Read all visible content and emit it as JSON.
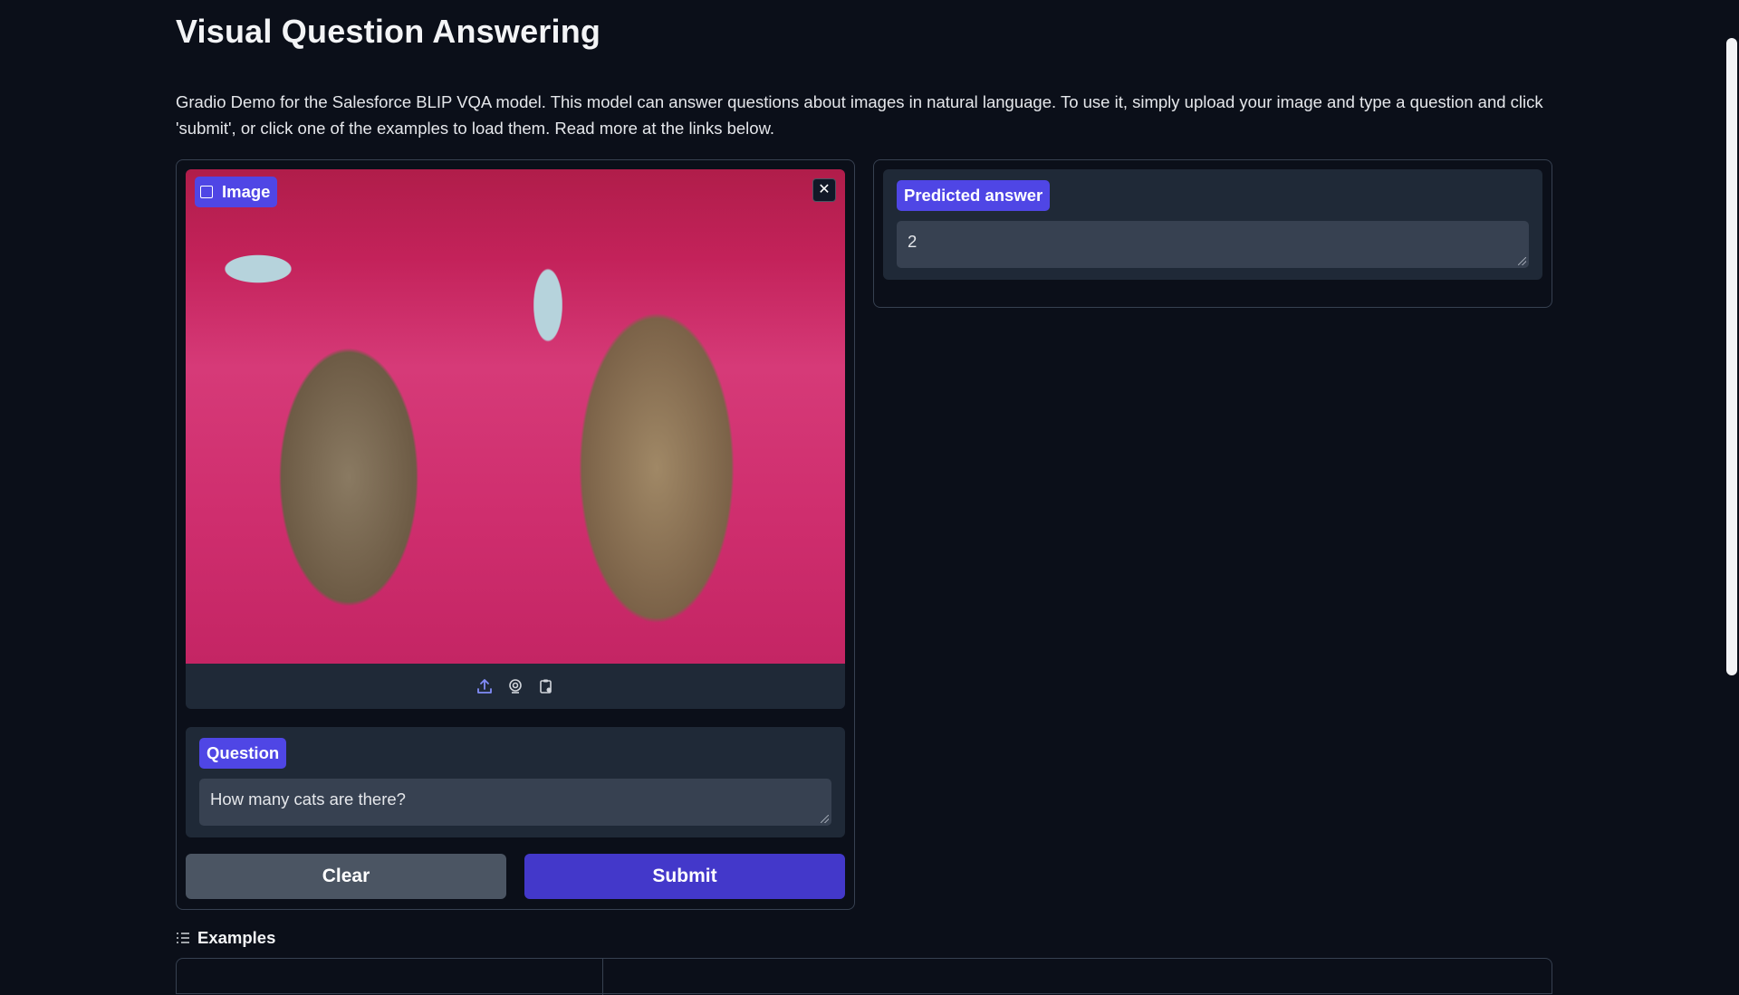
{
  "page": {
    "title": "Visual Question Answering",
    "description": "Gradio Demo for the Salesforce BLIP VQA model. This model can answer questions about images in natural language. To use it, simply upload your image and type a question and click 'submit', or click one of the examples to load them. Read more at the links below."
  },
  "image_input": {
    "label": "Image",
    "close_icon": "close-icon",
    "toolbar_icons": [
      "upload-icon",
      "webcam-icon",
      "clipboard-icon"
    ]
  },
  "question": {
    "label": "Question",
    "value": "How many cats are there?"
  },
  "buttons": {
    "clear_label": "Clear",
    "submit_label": "Submit"
  },
  "answer": {
    "label": "Predicted answer",
    "value": "2"
  },
  "examples": {
    "title": "Examples"
  },
  "colors": {
    "background": "#0b0f19",
    "panel": "#1f2937",
    "accent": "#4f46e5",
    "submit": "#4338ca",
    "clear": "#4b5563"
  }
}
